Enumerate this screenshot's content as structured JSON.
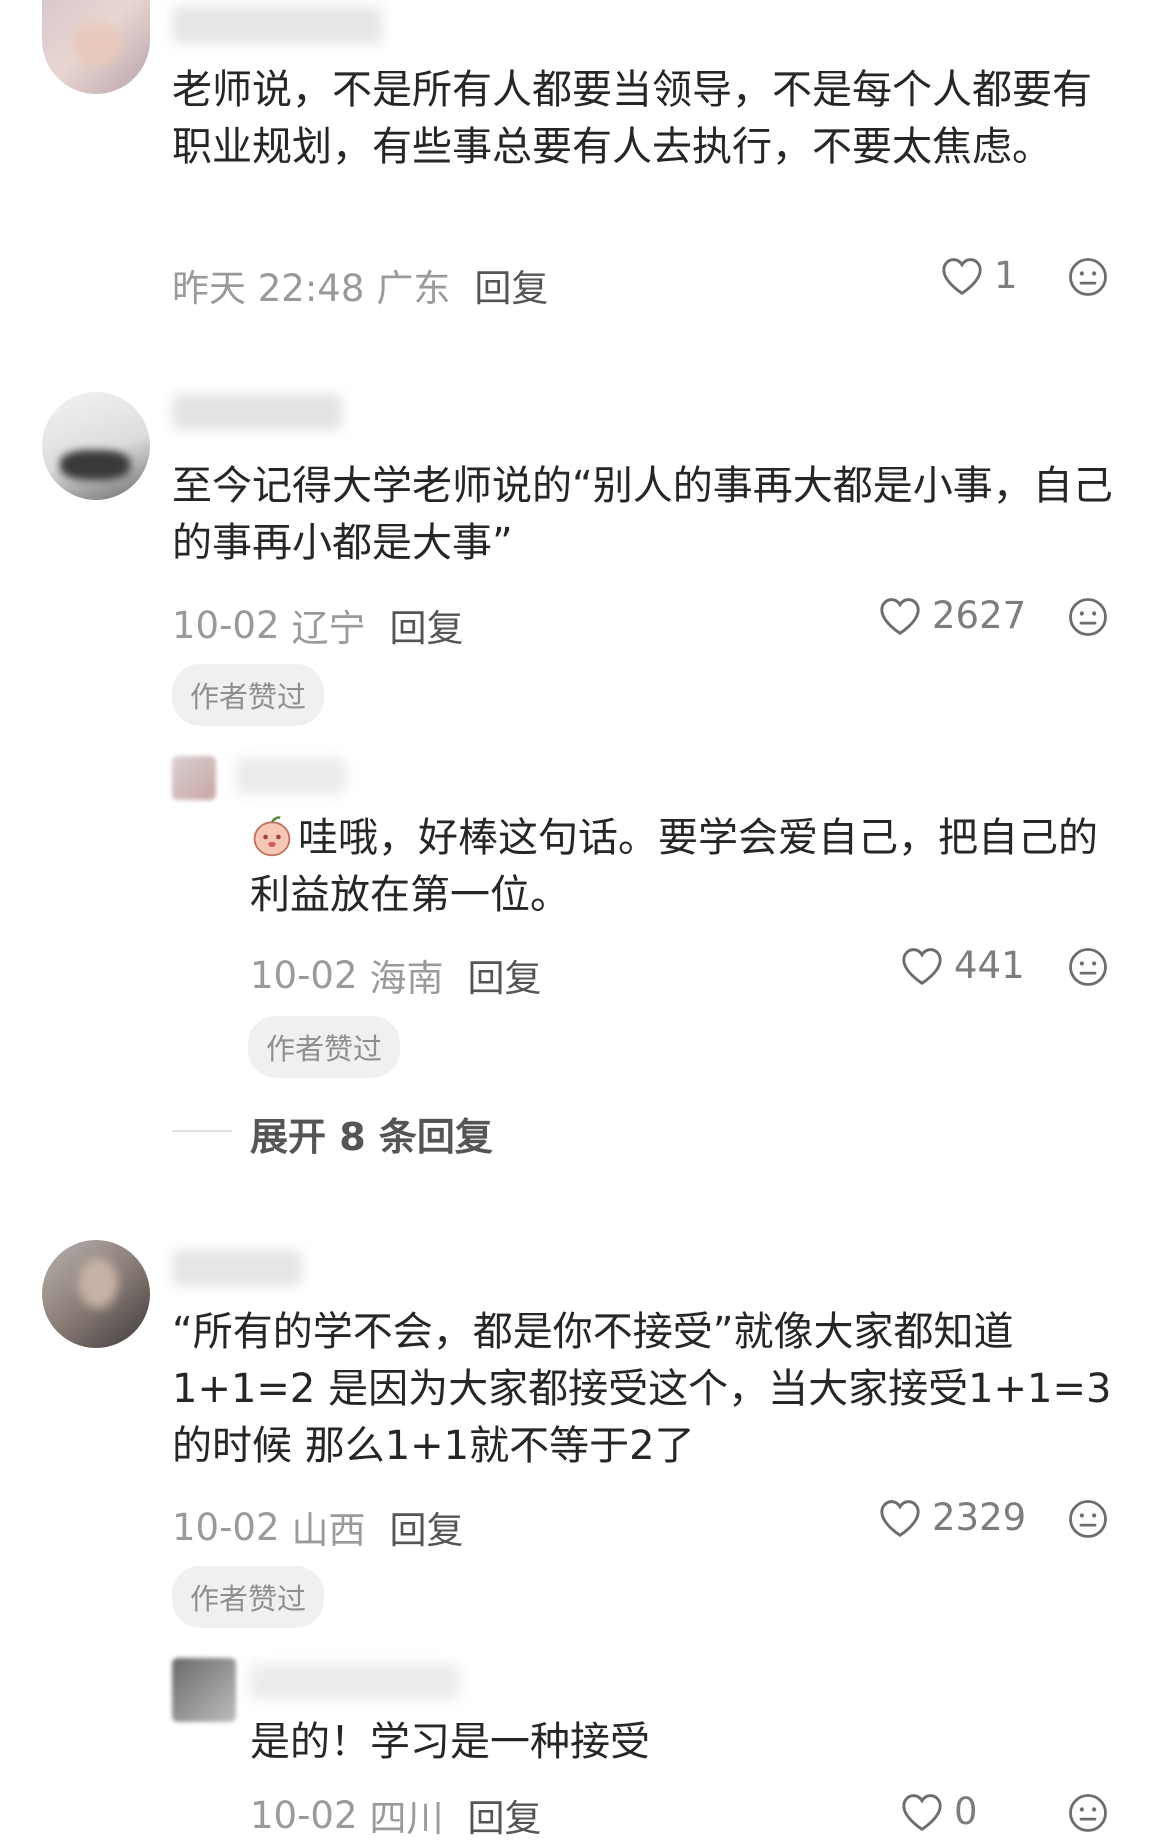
{
  "comments": [
    {
      "text": "老师说，不是所有人都要当领导，不是每个人都要有职业规划，有些事总要有人去执行，不要太焦虑。",
      "time": "昨天 22:48",
      "location": "广东",
      "reply_label": "回复",
      "likes": "1"
    },
    {
      "text": "至今记得大学老师说的“别人的事再大都是小事，自己的事再小都是大事”",
      "time": "10-02",
      "location": "辽宁",
      "reply_label": "回复",
      "likes": "2627",
      "badge": "作者赞过",
      "replies": [
        {
          "text": "哇哦，好棒这句话。要学会爱自己，把自己的利益放在第一位。",
          "time": "10-02",
          "location": "海南",
          "reply_label": "回复",
          "likes": "441",
          "badge": "作者赞过"
        }
      ],
      "expand_label": "展开 8 条回复"
    },
    {
      "text": "“所有的学不会，都是你不接受”就像大家都知道1+1=2 是因为大家都接受这个，当大家接受1+1=3的时候 那么1+1就不等于2了",
      "time": "10-02",
      "location": "山西",
      "reply_label": "回复",
      "likes": "2329",
      "badge": "作者赞过",
      "replies": [
        {
          "text": "是的！学习是一种接受",
          "time": "10-02",
          "location": "四川",
          "reply_label": "回复",
          "likes": "0"
        }
      ]
    }
  ],
  "icons": {
    "like": "heart-outline-icon",
    "dislike": "neutral-face-icon",
    "sticker": "peach-face-sticker-icon"
  },
  "colors": {
    "text": "#262626",
    "meta": "#9a9a9a",
    "badge_bg": "#f0f0f0",
    "badge_text": "#8f8f8f"
  }
}
